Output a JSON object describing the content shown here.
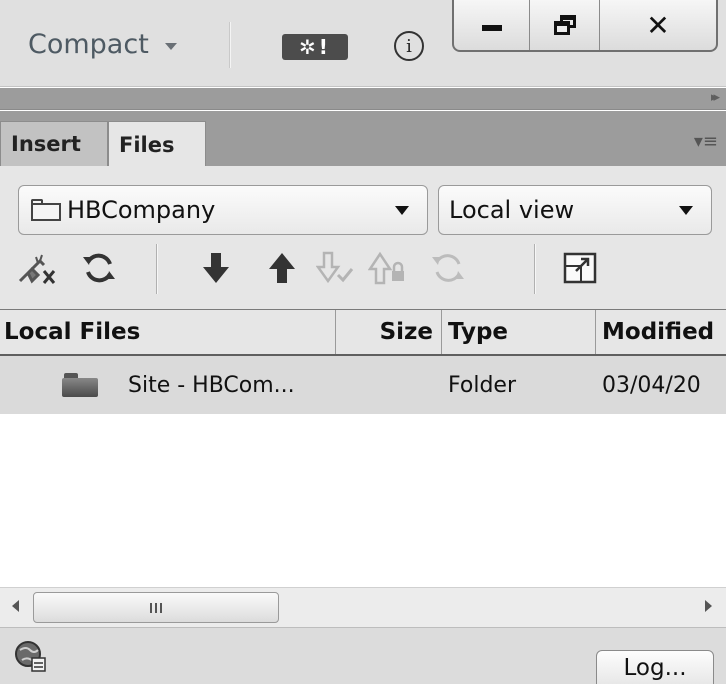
{
  "topbar": {
    "workspace_label": "Compact",
    "extension_icon_text": "✲!",
    "info_icon_text": "i",
    "window_controls": {
      "minimize_icon": "minimize-icon",
      "restore_icon": "restore-icon",
      "close_icon": "close-icon",
      "close_glyph": "✕"
    }
  },
  "panel": {
    "tabs": [
      {
        "label": "Insert",
        "active": false
      },
      {
        "label": "Files",
        "active": true
      }
    ],
    "site_select": {
      "value": "HBCompany"
    },
    "view_select": {
      "value": "Local view"
    },
    "toolbar_icons": [
      "disconnect-icon",
      "refresh-icon",
      "get-files-icon",
      "put-files-icon",
      "check-out-icon",
      "check-in-icon",
      "synchronize-icon",
      "expand-icon"
    ]
  },
  "file_list": {
    "columns": [
      "Local Files",
      "Size",
      "Type",
      "Modified"
    ],
    "rows": [
      {
        "name": "Site - HBCom...",
        "size": "",
        "type": "Folder",
        "modified": "03/04/20"
      }
    ]
  },
  "scrollbar": {
    "grip": "|||"
  },
  "status": {
    "log_button": "Log..."
  },
  "colors": {
    "topbar_bg": "#e0e0e0",
    "tabstrip_bg": "#9c9c9c",
    "panel_bg": "#e6e6e6",
    "selected_row_bg": "#dadada"
  }
}
